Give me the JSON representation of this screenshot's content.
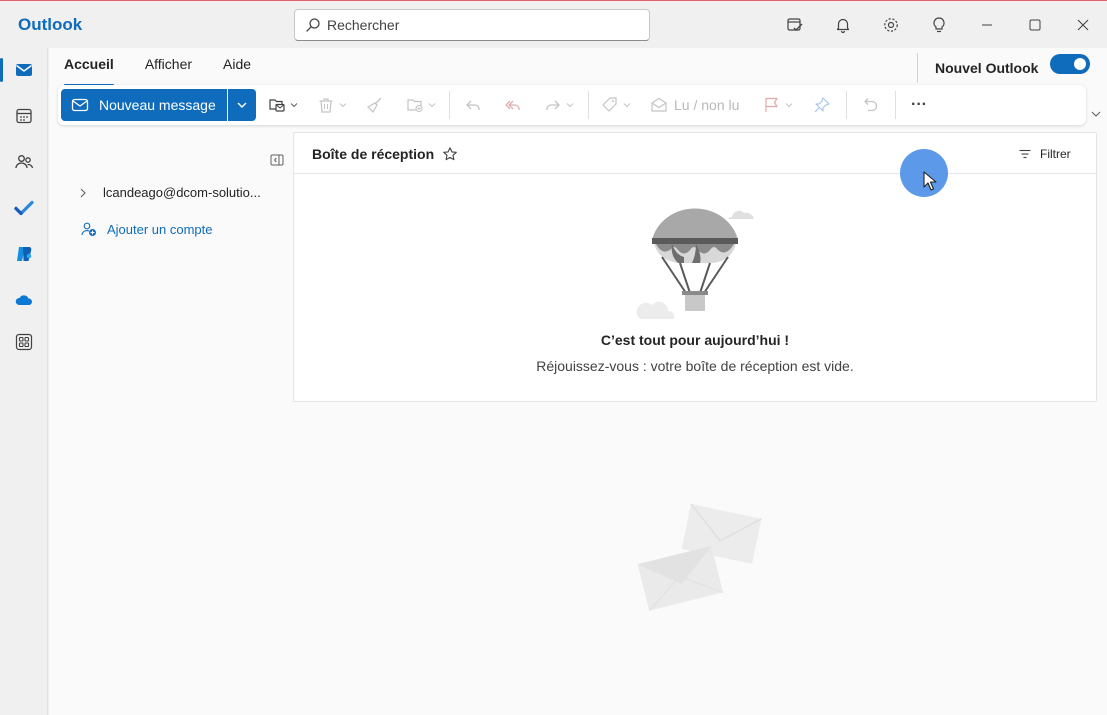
{
  "app": {
    "title": "Outlook"
  },
  "search": {
    "placeholder": "Rechercher"
  },
  "ribbon": {
    "tabs": [
      {
        "label": "Accueil",
        "active": true
      },
      {
        "label": "Afficher",
        "active": false
      },
      {
        "label": "Aide",
        "active": false
      }
    ],
    "new_outlook_label": "Nouvel Outlook",
    "new_outlook_enabled": true
  },
  "toolbar": {
    "new_message_label": "Nouveau message",
    "read_unread_label": "Lu / non lu",
    "more_label": "···"
  },
  "folders": {
    "account": "lcandeago@dcom-solutio...",
    "add_account_label": "Ajouter un compte"
  },
  "inbox": {
    "title": "Boîte de réception",
    "filter_label": "Filtrer",
    "empty_title": "C’est tout pour aujourd’hui !",
    "empty_subtitle": "Réjouissez-vous : votre boîte de réception est vide."
  },
  "colors": {
    "accent": "#0f6cbd",
    "background": "#f0f0f0",
    "panel": "#ffffff"
  },
  "icons": {
    "rail": [
      "mail-icon",
      "calendar-icon",
      "people-icon",
      "todo-icon",
      "copilot-icon",
      "onedrive-icon",
      "apps-icon"
    ],
    "titlebar": [
      "my-day-icon",
      "bell-icon",
      "gear-icon",
      "lightbulb-icon",
      "minimize-icon",
      "maximize-icon",
      "close-icon"
    ]
  }
}
